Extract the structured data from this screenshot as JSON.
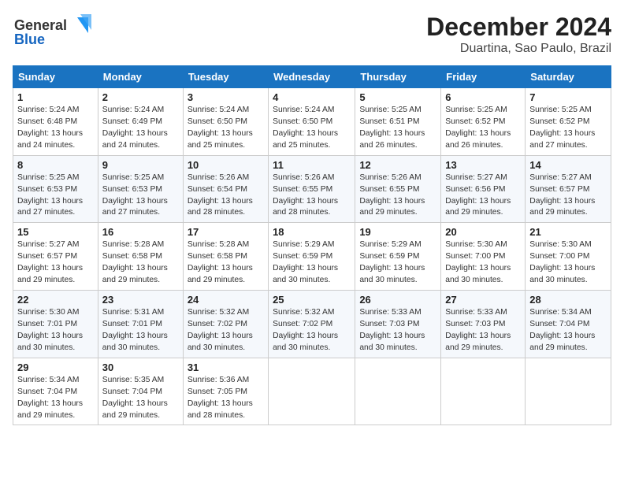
{
  "header": {
    "logo_line1": "General",
    "logo_line2": "Blue",
    "month": "December 2024",
    "location": "Duartina, Sao Paulo, Brazil"
  },
  "weekdays": [
    "Sunday",
    "Monday",
    "Tuesday",
    "Wednesday",
    "Thursday",
    "Friday",
    "Saturday"
  ],
  "weeks": [
    [
      {
        "day": "1",
        "sunrise": "5:24 AM",
        "sunset": "6:48 PM",
        "daylight": "13 hours and 24 minutes."
      },
      {
        "day": "2",
        "sunrise": "5:24 AM",
        "sunset": "6:49 PM",
        "daylight": "13 hours and 24 minutes."
      },
      {
        "day": "3",
        "sunrise": "5:24 AM",
        "sunset": "6:50 PM",
        "daylight": "13 hours and 25 minutes."
      },
      {
        "day": "4",
        "sunrise": "5:24 AM",
        "sunset": "6:50 PM",
        "daylight": "13 hours and 25 minutes."
      },
      {
        "day": "5",
        "sunrise": "5:25 AM",
        "sunset": "6:51 PM",
        "daylight": "13 hours and 26 minutes."
      },
      {
        "day": "6",
        "sunrise": "5:25 AM",
        "sunset": "6:52 PM",
        "daylight": "13 hours and 26 minutes."
      },
      {
        "day": "7",
        "sunrise": "5:25 AM",
        "sunset": "6:52 PM",
        "daylight": "13 hours and 27 minutes."
      }
    ],
    [
      {
        "day": "8",
        "sunrise": "5:25 AM",
        "sunset": "6:53 PM",
        "daylight": "13 hours and 27 minutes."
      },
      {
        "day": "9",
        "sunrise": "5:25 AM",
        "sunset": "6:53 PM",
        "daylight": "13 hours and 27 minutes."
      },
      {
        "day": "10",
        "sunrise": "5:26 AM",
        "sunset": "6:54 PM",
        "daylight": "13 hours and 28 minutes."
      },
      {
        "day": "11",
        "sunrise": "5:26 AM",
        "sunset": "6:55 PM",
        "daylight": "13 hours and 28 minutes."
      },
      {
        "day": "12",
        "sunrise": "5:26 AM",
        "sunset": "6:55 PM",
        "daylight": "13 hours and 29 minutes."
      },
      {
        "day": "13",
        "sunrise": "5:27 AM",
        "sunset": "6:56 PM",
        "daylight": "13 hours and 29 minutes."
      },
      {
        "day": "14",
        "sunrise": "5:27 AM",
        "sunset": "6:57 PM",
        "daylight": "13 hours and 29 minutes."
      }
    ],
    [
      {
        "day": "15",
        "sunrise": "5:27 AM",
        "sunset": "6:57 PM",
        "daylight": "13 hours and 29 minutes."
      },
      {
        "day": "16",
        "sunrise": "5:28 AM",
        "sunset": "6:58 PM",
        "daylight": "13 hours and 29 minutes."
      },
      {
        "day": "17",
        "sunrise": "5:28 AM",
        "sunset": "6:58 PM",
        "daylight": "13 hours and 29 minutes."
      },
      {
        "day": "18",
        "sunrise": "5:29 AM",
        "sunset": "6:59 PM",
        "daylight": "13 hours and 30 minutes."
      },
      {
        "day": "19",
        "sunrise": "5:29 AM",
        "sunset": "6:59 PM",
        "daylight": "13 hours and 30 minutes."
      },
      {
        "day": "20",
        "sunrise": "5:30 AM",
        "sunset": "7:00 PM",
        "daylight": "13 hours and 30 minutes."
      },
      {
        "day": "21",
        "sunrise": "5:30 AM",
        "sunset": "7:00 PM",
        "daylight": "13 hours and 30 minutes."
      }
    ],
    [
      {
        "day": "22",
        "sunrise": "5:30 AM",
        "sunset": "7:01 PM",
        "daylight": "13 hours and 30 minutes."
      },
      {
        "day": "23",
        "sunrise": "5:31 AM",
        "sunset": "7:01 PM",
        "daylight": "13 hours and 30 minutes."
      },
      {
        "day": "24",
        "sunrise": "5:32 AM",
        "sunset": "7:02 PM",
        "daylight": "13 hours and 30 minutes."
      },
      {
        "day": "25",
        "sunrise": "5:32 AM",
        "sunset": "7:02 PM",
        "daylight": "13 hours and 30 minutes."
      },
      {
        "day": "26",
        "sunrise": "5:33 AM",
        "sunset": "7:03 PM",
        "daylight": "13 hours and 30 minutes."
      },
      {
        "day": "27",
        "sunrise": "5:33 AM",
        "sunset": "7:03 PM",
        "daylight": "13 hours and 29 minutes."
      },
      {
        "day": "28",
        "sunrise": "5:34 AM",
        "sunset": "7:04 PM",
        "daylight": "13 hours and 29 minutes."
      }
    ],
    [
      {
        "day": "29",
        "sunrise": "5:34 AM",
        "sunset": "7:04 PM",
        "daylight": "13 hours and 29 minutes."
      },
      {
        "day": "30",
        "sunrise": "5:35 AM",
        "sunset": "7:04 PM",
        "daylight": "13 hours and 29 minutes."
      },
      {
        "day": "31",
        "sunrise": "5:36 AM",
        "sunset": "7:05 PM",
        "daylight": "13 hours and 28 minutes."
      },
      null,
      null,
      null,
      null
    ]
  ]
}
